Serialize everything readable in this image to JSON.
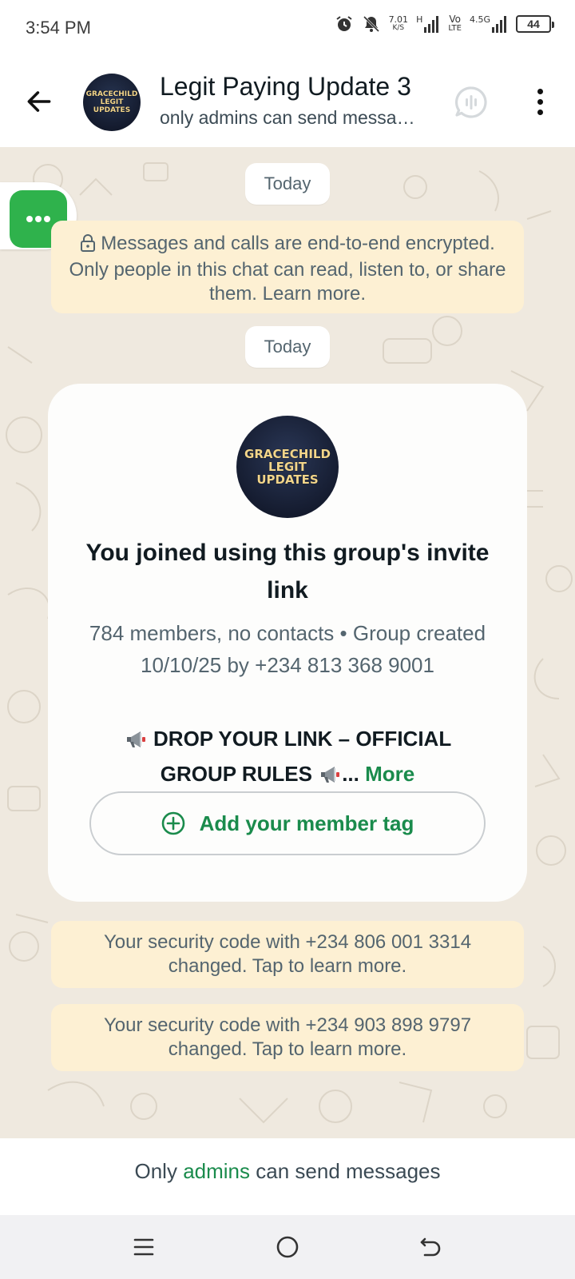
{
  "status_bar": {
    "time": "3:54 PM",
    "net_speed_value": "7.01",
    "net_speed_unit": "K/S",
    "network_h": "H",
    "volte_top": "Vo",
    "volte_bottom": "LTE",
    "network_45g": "4.5G",
    "battery_level": "44"
  },
  "header": {
    "title": "Legit Paying Update 3",
    "subtitle": "only admins can send messa…",
    "avatar_line1": "GRACECHILD",
    "avatar_line2": "LEGIT UPDATES"
  },
  "chat": {
    "date_chip_1": "Today",
    "date_chip_2": "Today",
    "encryption_notice": "Messages and calls are end-to-end encrypted. Only people in this chat can read, listen to, or share them. Learn more.",
    "card": {
      "avatar_line1": "GRACECHILD",
      "avatar_line2": "LEGIT UPDATES",
      "title": "You joined using this group's invite link",
      "subtitle": "784 members, no contacts • Group created 10/10/25 by +234 813 368 9001",
      "rules_line1": "DROP YOUR LINK – OFFICIAL",
      "rules_line2": "GROUP RULES",
      "rules_ellipsis": "...",
      "more_label": "More",
      "member_tag_label": "Add your member tag"
    },
    "security_notice_1": "Your security code with +234 806 001 3314 changed. Tap to learn more.",
    "security_notice_2": "Your security code with +234 903 898 9797 changed. Tap to learn more."
  },
  "footer": {
    "prefix": "Only",
    "link": "admins",
    "suffix": "can send messages"
  },
  "colors": {
    "accent_green": "#1a8b4c",
    "fab_green": "#2fb24c",
    "chat_bg": "#efe9df",
    "notice_bg": "#fdf0d3"
  }
}
